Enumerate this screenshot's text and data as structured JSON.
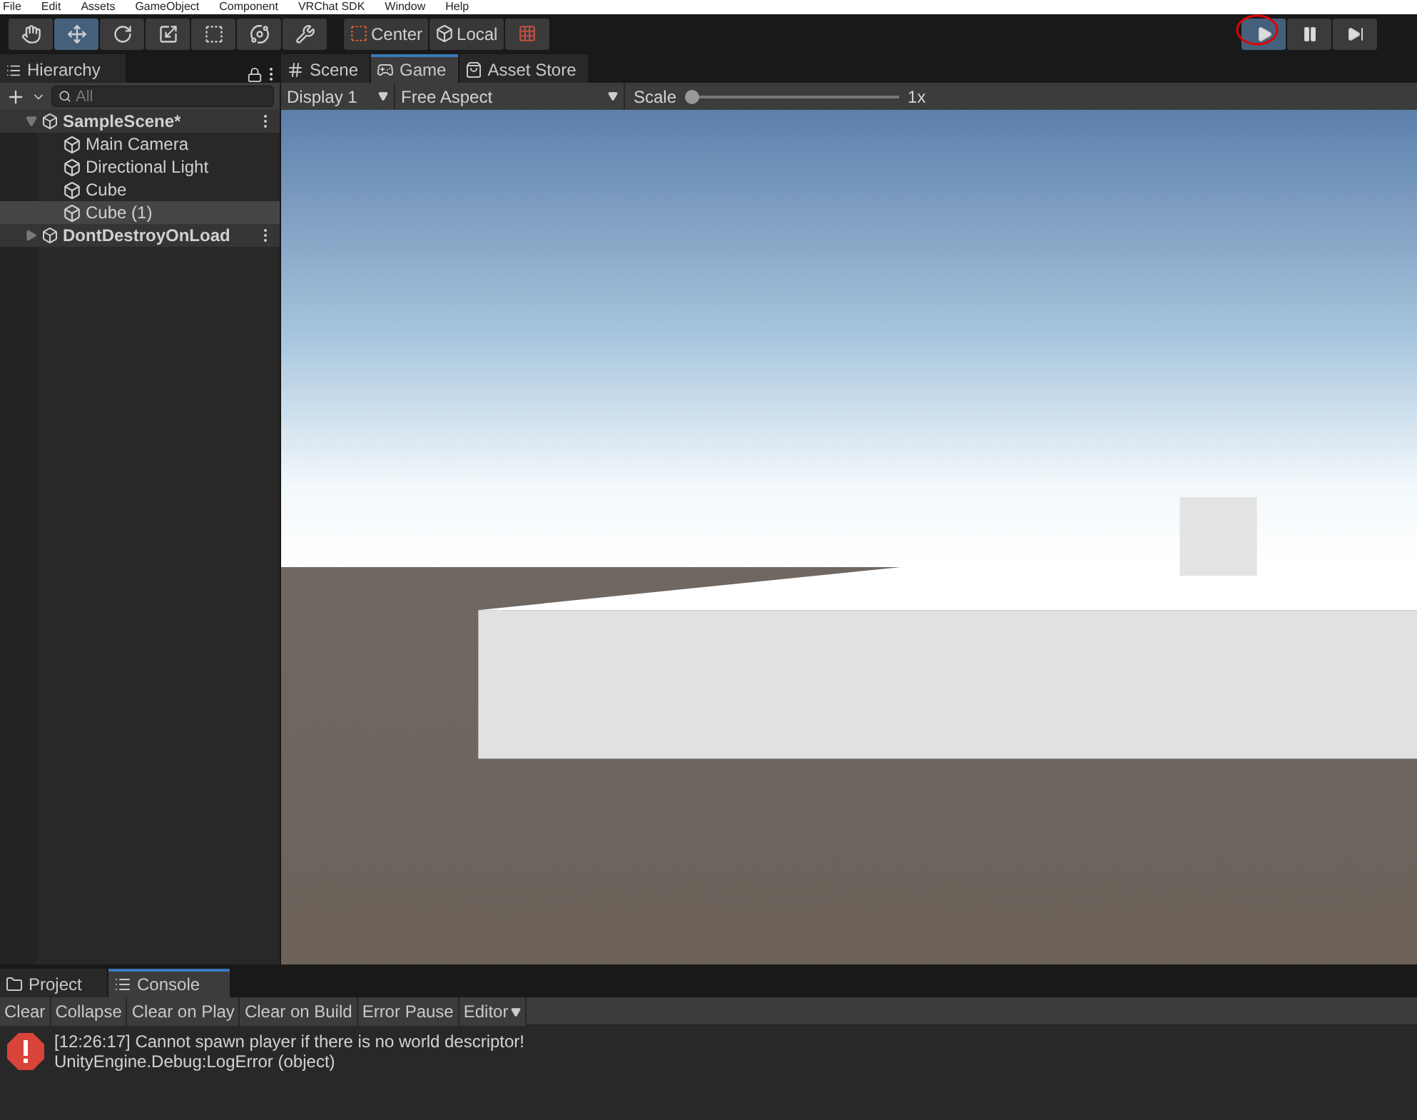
{
  "menu": [
    "File",
    "Edit",
    "Assets",
    "GameObject",
    "Component",
    "VRChat SDK",
    "Window",
    "Help"
  ],
  "tools": [
    {
      "kind": "hand",
      "selected": false
    },
    {
      "kind": "move",
      "selected": true
    },
    {
      "kind": "rotate",
      "selected": false
    },
    {
      "kind": "scale",
      "selected": false
    },
    {
      "kind": "rect",
      "selected": false
    },
    {
      "kind": "transform",
      "selected": false
    },
    {
      "kind": "custom",
      "selected": false
    }
  ],
  "pivot": [
    {
      "kind": "center",
      "label": "Center"
    },
    {
      "kind": "local",
      "label": "Local"
    }
  ],
  "play_controls": [
    {
      "kind": "play",
      "on": true
    },
    {
      "kind": "pause",
      "on": false
    },
    {
      "kind": "step",
      "on": false
    }
  ],
  "hierarchy": {
    "title": "Hierarchy",
    "search": {
      "placeholder": "All"
    },
    "items": [
      {
        "label": "SampleScene*",
        "kind": "scene",
        "expanded": true,
        "selected": false,
        "children": [
          {
            "label": "Main Camera",
            "kind": "object",
            "selected": false
          },
          {
            "label": "Directional Light",
            "kind": "object",
            "selected": false
          },
          {
            "label": "Cube",
            "kind": "object",
            "selected": false
          },
          {
            "label": "Cube (1)",
            "kind": "object",
            "selected": true
          }
        ]
      },
      {
        "label": "DontDestroyOnLoad",
        "kind": "scene",
        "expanded": false,
        "selected": false
      }
    ]
  },
  "view_tabs": [
    {
      "kind": "scene",
      "label": "Scene",
      "selected": false
    },
    {
      "kind": "game",
      "label": "Game",
      "selected": true
    },
    {
      "kind": "store",
      "label": "Asset Store",
      "selected": false
    }
  ],
  "game_toolbar": {
    "display": "Display 1",
    "aspect": "Free Aspect",
    "scale_label": "Scale",
    "scale": {
      "level": 0
    },
    "scale_reading": "1x"
  },
  "bottom_tabs": [
    {
      "kind": "project",
      "label": "Project",
      "selected": false
    },
    {
      "kind": "console",
      "label": "Console",
      "selected": true
    }
  ],
  "console": {
    "buttons": [
      {
        "label": "Clear",
        "dropdown": false
      },
      {
        "label": "Collapse",
        "dropdown": false
      },
      {
        "label": "Clear on Play",
        "dropdown": false
      },
      {
        "label": "Clear on Build",
        "dropdown": false
      },
      {
        "label": "Error Pause",
        "dropdown": false
      },
      {
        "label": "Editor",
        "dropdown": true
      }
    ],
    "entries": [
      {
        "kind": "error",
        "message": "[12:26:17] Cannot spawn player if there is no world descriptor!",
        "detail": "UnityEngine.Debug:LogError (object)"
      }
    ]
  }
}
